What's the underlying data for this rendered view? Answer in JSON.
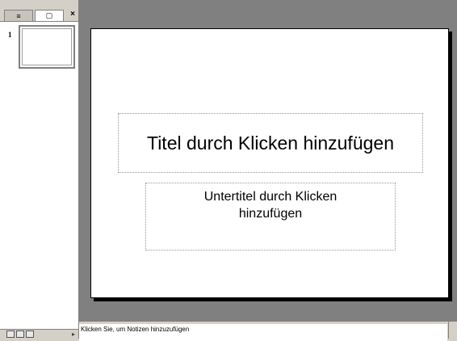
{
  "left_pane": {
    "tabs": [
      {
        "icon": "outline-icon",
        "glyph": "≡"
      },
      {
        "icon": "slides-icon",
        "glyph": "▢"
      }
    ],
    "close_glyph": "×",
    "slides": [
      {
        "number": "1"
      }
    ]
  },
  "slide": {
    "title_placeholder": "Titel durch Klicken hinzufügen",
    "subtitle_placeholder": "Untertitel durch Klicken hinzufügen"
  },
  "notes": {
    "placeholder": "Klicken Sie, um Notizen hinzuzufügen"
  },
  "view_bar": {
    "arrow_glyph": "▸"
  }
}
